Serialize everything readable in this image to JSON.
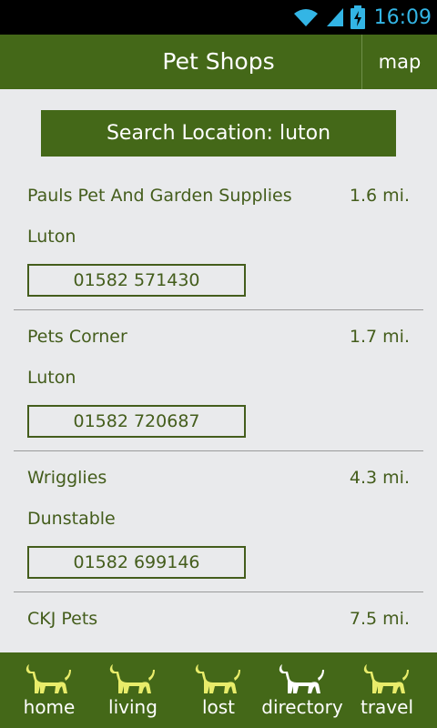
{
  "status_bar": {
    "time": "16:09",
    "icons": [
      "wifi-icon",
      "signal-icon",
      "battery-charging-icon"
    ],
    "clock_color": "#33b5e5"
  },
  "header": {
    "title": "Pet Shops",
    "map_label": "map",
    "background": "#446818"
  },
  "search": {
    "label": "Search Location: luton"
  },
  "shops": [
    {
      "name": "Pauls Pet And Garden Supplies",
      "distance": "1.6 mi.",
      "town": "Luton",
      "phone": "01582 571430"
    },
    {
      "name": "Pets Corner",
      "distance": "1.7 mi.",
      "town": "Luton",
      "phone": "01582 720687"
    },
    {
      "name": "Wrigglies",
      "distance": "4.3 mi.",
      "town": "Dunstable",
      "phone": "01582 699146"
    },
    {
      "name": "CKJ Pets",
      "distance": "7.5 mi.",
      "town": "",
      "phone": ""
    }
  ],
  "nav": {
    "items": [
      {
        "label": "home",
        "icon": "dog-icon",
        "active": false
      },
      {
        "label": "living",
        "icon": "dog-icon",
        "active": false
      },
      {
        "label": "lost",
        "icon": "dog-icon",
        "active": false
      },
      {
        "label": "directory",
        "icon": "dog-icon",
        "active": true
      },
      {
        "label": "travel",
        "icon": "dog-icon",
        "active": false
      }
    ],
    "inactive_icon_color": "#e8ec6a",
    "active_icon_color": "#ffffff"
  },
  "colors": {
    "accent_green": "#446818",
    "text_green": "#445d1c",
    "background": "#e9eaec"
  }
}
